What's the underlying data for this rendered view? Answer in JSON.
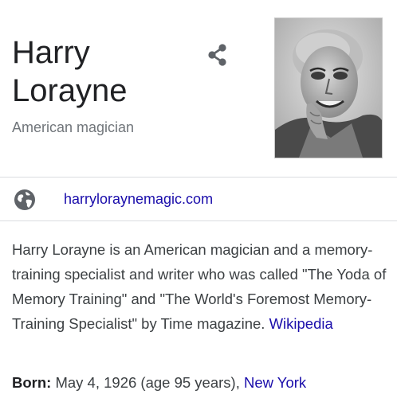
{
  "entity": {
    "name": "Harry Lorayne",
    "subtitle": "American magician"
  },
  "share": {
    "icon": "share-icon"
  },
  "portrait": {
    "icon": "portrait-photo"
  },
  "website": {
    "icon": "globe-icon",
    "label": "harryloraynemagic.com"
  },
  "description": {
    "text": "Harry Lorayne is an American magician and a memory-training specialist and writer who was called \"The Yoda of Memory Training\" and \"The World's Foremost Memory-Training Specialist\" by Time magazine. ",
    "source_link": "Wikipedia"
  },
  "born": {
    "label": "Born:",
    "value": " May 4, 1926 (age 95 years), ",
    "place_link": "New York"
  },
  "colors": {
    "link": "#1a0dab",
    "subtitle": "#70757a",
    "body_text": "#3c4043",
    "divider": "#dadce0",
    "icon": "#5f6368"
  }
}
